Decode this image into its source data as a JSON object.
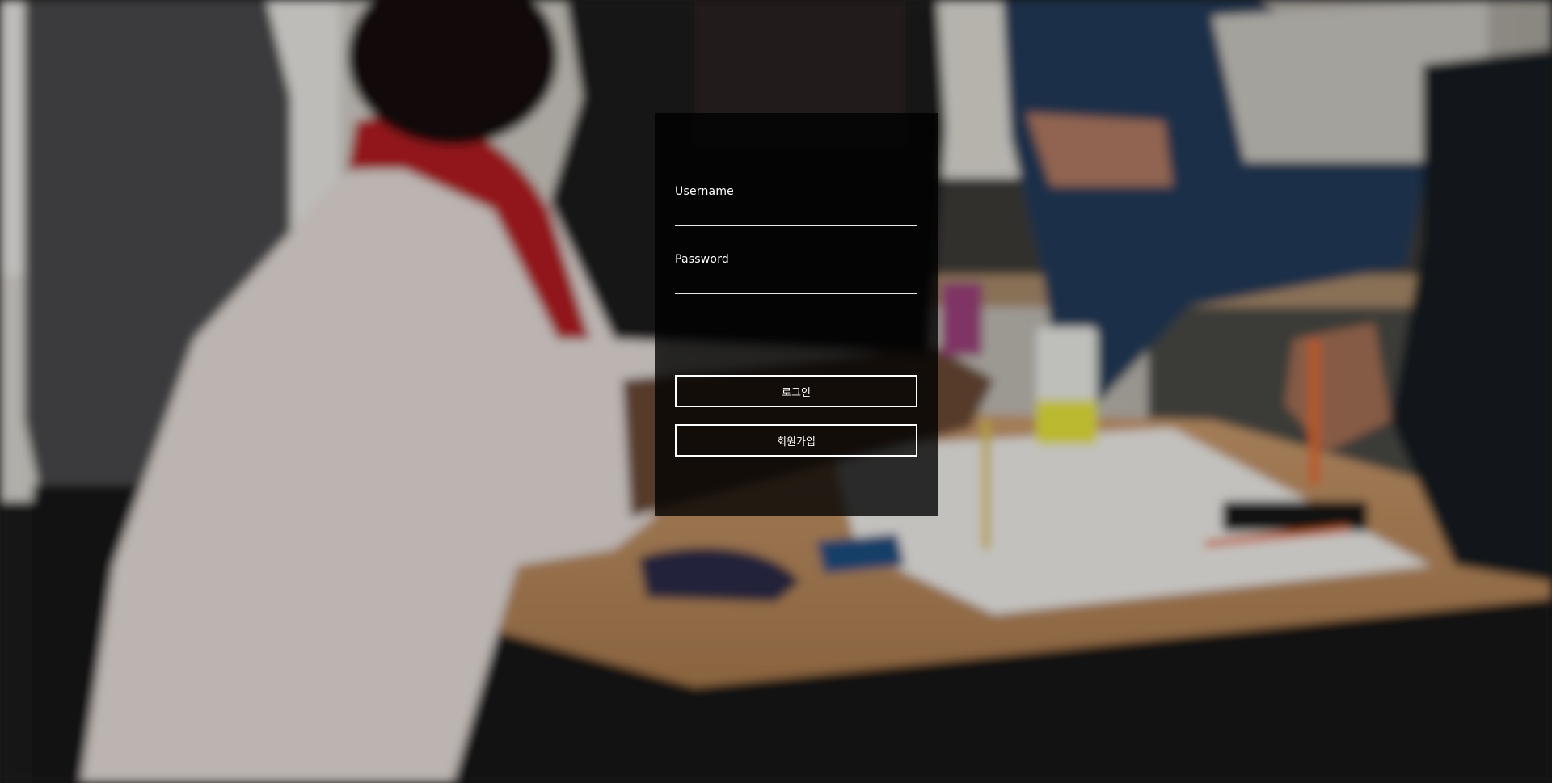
{
  "login_form": {
    "username_label": "Username",
    "username_value": "",
    "password_label": "Password",
    "password_value": "",
    "login_button_label": "로그인",
    "signup_button_label": "회원가입"
  },
  "background": {
    "kind": "blurred-photo"
  }
}
